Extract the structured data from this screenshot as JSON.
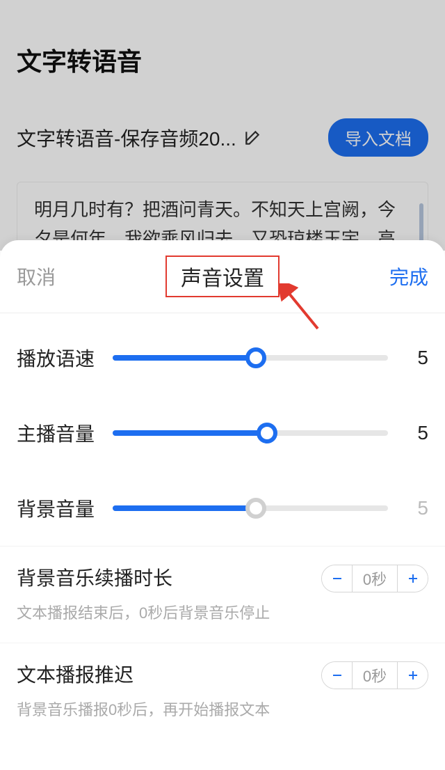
{
  "background": {
    "title": "文字转语音",
    "subtitle": "文字转语音-保存音频20...",
    "import_button": "导入文档",
    "text_content": "明月几时有？把酒问青天。不知天上宫阙，今夕是何年。我欲乘风归去，又恐琼楼玉宇，高处不胜寒。起舞弄清影，何似在人间。\n转朱阁，低绮户，照无眠。不应有恨，何事长向"
  },
  "sheet": {
    "cancel": "取消",
    "title": "声音设置",
    "done": "完成",
    "sliders": {
      "speed": {
        "label": "播放语速",
        "value": "5",
        "percent": 52
      },
      "voice_volume": {
        "label": "主播音量",
        "value": "5",
        "percent": 56
      },
      "bg_volume": {
        "label": "背景音量",
        "value": "5",
        "percent": 52
      }
    },
    "steppers": {
      "bg_continue": {
        "title": "背景音乐续播时长",
        "desc": "文本播报结束后，0秒后背景音乐停止",
        "value": "0秒"
      },
      "text_delay": {
        "title": "文本播报推迟",
        "desc": "背景音乐播报0秒后，再开始播报文本",
        "value": "0秒"
      }
    }
  }
}
